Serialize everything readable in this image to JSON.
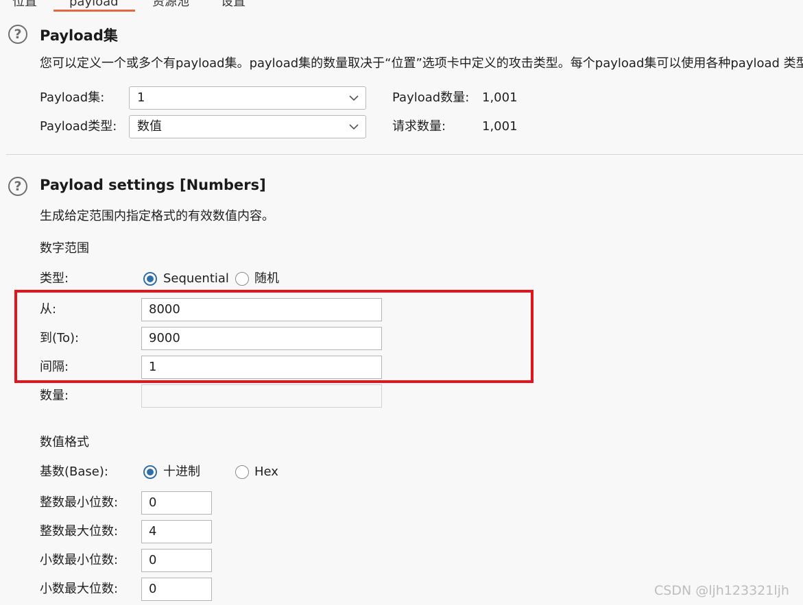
{
  "tabs": [
    {
      "label": "位置"
    },
    {
      "label": "payload"
    },
    {
      "label": "资源池"
    },
    {
      "label": "设置"
    }
  ],
  "active_tab": "payload",
  "accent_color": "#e8663d",
  "payload_sets": {
    "title": "Payload集",
    "description": "您可以定义一个或多个有payload集。payload集的数量取决于“位置”选项卡中定义的攻击类型。每个payload集可以使用各种payload 类型",
    "set_label": "Payload集:",
    "set_value": "1",
    "type_label": "Payload类型:",
    "type_value": "数值",
    "count_label": "Payload数量:",
    "count_value": "1,001",
    "requests_label": "请求数量:",
    "requests_value": "1,001"
  },
  "payload_settings": {
    "title": "Payload settings [Numbers]",
    "description": "生成给定范围内指定格式的有效数值内容。",
    "range_heading": "数字范围",
    "type_label": "类型:",
    "type_options": [
      "Sequential",
      "随机"
    ],
    "type_selected": "Sequential",
    "from_label": "从:",
    "from_value": "8000",
    "to_label": "到(To):",
    "to_value": "9000",
    "step_label": "间隔:",
    "step_value": "1",
    "howmany_label": "数量:",
    "howmany_value": "",
    "format_heading": "数值格式",
    "base_label": "基数(Base):",
    "base_options": [
      "十进制",
      "Hex"
    ],
    "base_selected": "十进制",
    "min_int_label": "整数最小位数:",
    "min_int_value": "0",
    "max_int_label": "整数最大位数:",
    "max_int_value": "4",
    "min_frac_label": "小数最小位数:",
    "min_frac_value": "0",
    "max_frac_label": "小数最大位数:",
    "max_frac_value": "0"
  },
  "highlight_color": "#e3141c",
  "watermark": "CSDN @ljh123321ljh"
}
